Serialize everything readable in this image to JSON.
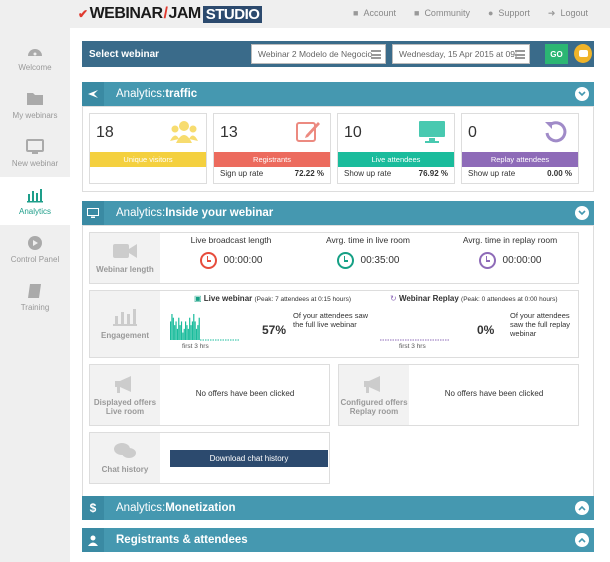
{
  "header": {
    "logo_a": "WEBINAR",
    "logo_b": "JAM",
    "logo_c": "STUDIO",
    "account": "Account",
    "community": "Community",
    "support": "Support",
    "logout": "Logout"
  },
  "sidebar": {
    "items": [
      {
        "label": "Welcome",
        "icon": "gauge-icon"
      },
      {
        "label": "My webinars",
        "icon": "folder-icon"
      },
      {
        "label": "New webinar",
        "icon": "monitor-icon"
      },
      {
        "label": "Analytics",
        "icon": "bar-chart-icon"
      },
      {
        "label": "Control Panel",
        "icon": "play-circle-icon"
      },
      {
        "label": "Training",
        "icon": "book-icon"
      }
    ]
  },
  "select": {
    "title": "Select webinar",
    "webinar": "Webinar 2 Modelo de Negocio",
    "date": "Wednesday, 15 Apr 2015 at 09:",
    "go": "GO"
  },
  "traffic": {
    "title_a": "Analytics: ",
    "title_b": "traffic",
    "cards": [
      {
        "value": "18",
        "label": "Unique visitors",
        "color": "#f4d03f",
        "rate_label": "",
        "rate": ""
      },
      {
        "value": "13",
        "label": "Registrants",
        "color": "#ec6b5e",
        "rate_label": "Sign up rate",
        "rate": "72.22 %"
      },
      {
        "value": "10",
        "label": "Live attendees",
        "color": "#1abc9c",
        "rate_label": "Show up rate",
        "rate": "76.92 %"
      },
      {
        "value": "0",
        "label": "Replay attendees",
        "color": "#8e6bb8",
        "rate_label": "Show up rate",
        "rate": "0.00 %"
      }
    ]
  },
  "inside": {
    "title_a": "Analytics: ",
    "title_b": "Inside your webinar",
    "length_label": "Webinar length",
    "timers": [
      {
        "label": "Live broadcast length",
        "value": "00:00:00",
        "color": "#e74c3c"
      },
      {
        "label": "Avrg. time in live room",
        "value": "00:35:00",
        "color": "#16a085"
      },
      {
        "label": "Avrg. time in replay room",
        "value": "00:00:00",
        "color": "#8e6bb8"
      }
    ],
    "engagement_label": "Engagement",
    "live": {
      "title": "Live webinar",
      "peak": "(Peak: 7 attendees at 0:15 hours)",
      "pct": "57%",
      "desc": "Of your attendees saw the full live webinar",
      "axis": "first 3 hrs"
    },
    "replay": {
      "title": "Webinar Replay",
      "peak": "(Peak: 0 attendees at 0:00 hours)",
      "pct": "0%",
      "desc": "Of your attendees saw the full replay webinar",
      "axis": "first 3 hrs"
    },
    "displayed_offers_a": "Displayed offers",
    "displayed_offers_b": "Live room",
    "displayed_offers_msg": "No offers have been clicked",
    "configured_offers_a": "Configured offers",
    "configured_offers_b": "Replay room",
    "configured_offers_msg": "No offers have been clicked",
    "chat_label": "Chat history",
    "chat_button": "Download chat history"
  },
  "engagement_chart": {
    "series": [
      {
        "name": "Live webinar",
        "values": [
          5,
          7,
          6,
          4,
          5,
          3,
          6,
          4,
          5,
          2,
          3,
          5,
          4,
          3,
          6,
          4,
          5,
          7,
          5,
          3,
          4,
          6
        ]
      }
    ],
    "ylim": [
      0,
      7
    ]
  },
  "monetization": {
    "title_a": "Analytics: ",
    "title_b": "Monetization"
  },
  "registrants": {
    "title": "Registrants & attendees"
  }
}
